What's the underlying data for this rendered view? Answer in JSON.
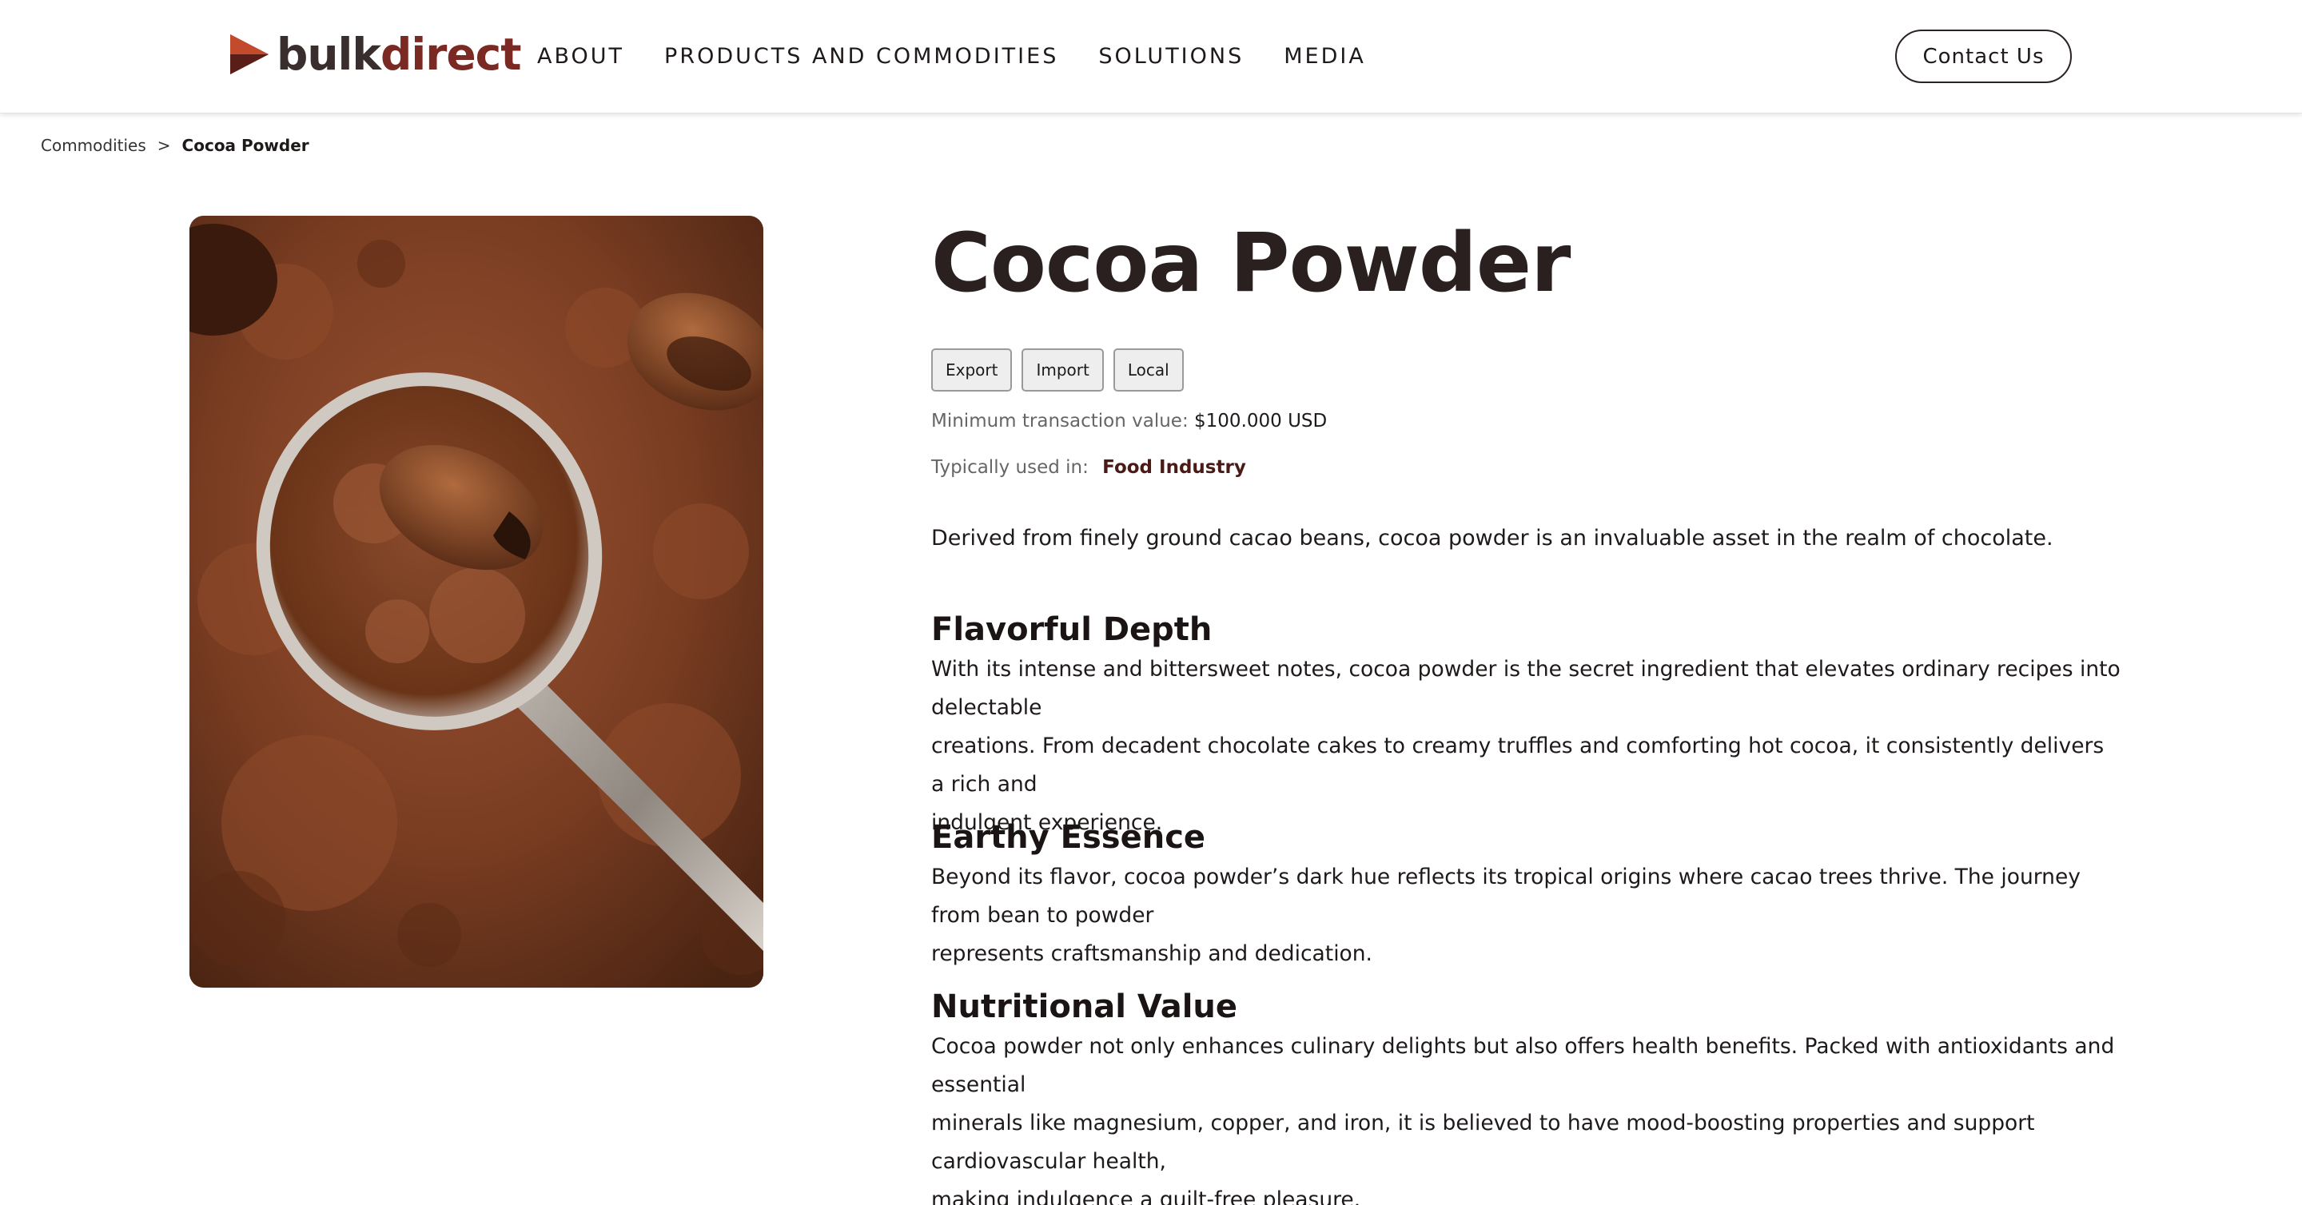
{
  "header": {
    "logo": {
      "bulk": "bulk",
      "direct": "direct",
      "brand_colors": [
        "#7a2a22",
        "#c24b2c",
        "#3a2d2d"
      ]
    },
    "nav": [
      "ABOUT",
      "PRODUCTS AND COMMODITIES",
      "SOLUTIONS",
      "MEDIA"
    ],
    "contact_label": "Contact Us"
  },
  "breadcrumb": {
    "parent": "Commodities",
    "separator": ">",
    "current": "Cocoa Powder"
  },
  "product": {
    "image_alt": "cocoa-powder-spoon-photo",
    "title": "Cocoa Powder",
    "tags": [
      "Export",
      "Import",
      "Local"
    ],
    "min_transaction_label": "Minimum transaction value:",
    "min_transaction_value": "$100.000 USD",
    "used_in_label": "Typically used in:",
    "used_in_value": "Food Industry",
    "intro": "Derived from finely ground cacao beans, cocoa powder is an invaluable asset in the realm of chocolate.",
    "sections": [
      {
        "heading": "Flavorful Depth",
        "lines": [
          "With its intense and bittersweet notes, cocoa powder is the secret ingredient that elevates ordinary recipes into delectable",
          "creations. From decadent chocolate cakes to creamy truffles and comforting hot cocoa, it consistently delivers a rich and",
          "indulgent experience."
        ]
      },
      {
        "heading": "Earthy Essence",
        "lines": [
          "Beyond its flavor, cocoa powder’s dark hue reflects its tropical origins where cacao trees thrive. The journey from bean to powder",
          "represents craftsmanship and dedication."
        ]
      },
      {
        "heading": "Nutritional Value",
        "lines": [
          "Cocoa powder not only enhances culinary delights but also offers health benefits. Packed with antioxidants and essential",
          "minerals like magnesium, copper, and iron, it is believed to have mood-boosting properties and support cardiovascular health,",
          "making indulgence a guilt-free pleasure."
        ]
      }
    ]
  }
}
